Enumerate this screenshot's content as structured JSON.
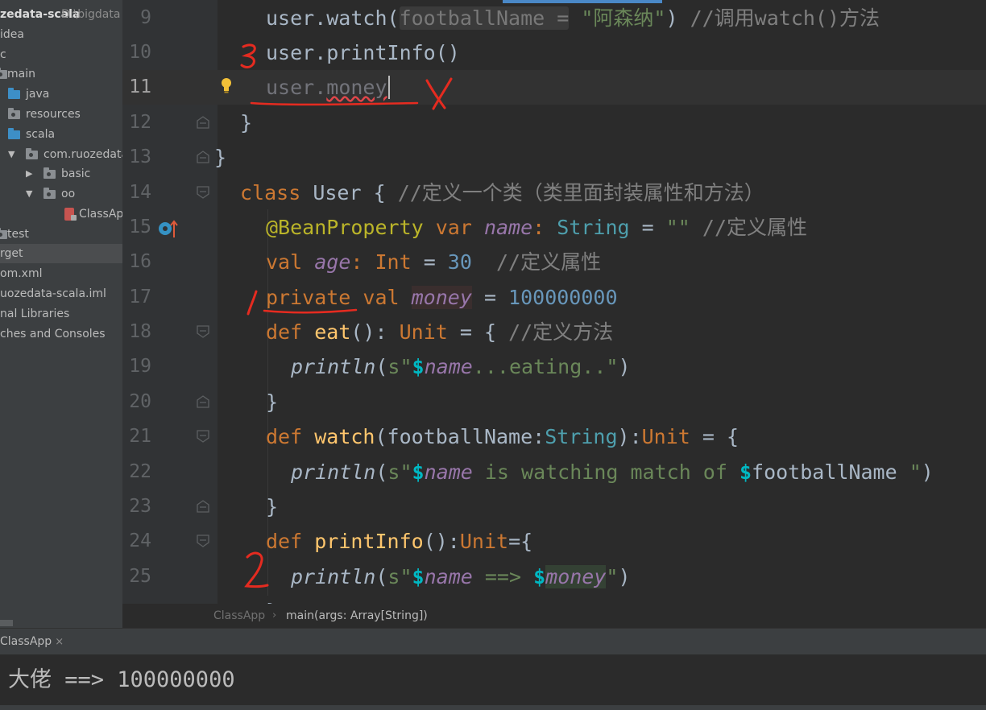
{
  "sidebar": {
    "project": {
      "name": "zedata-scala",
      "path": "D:\\bigdata"
    },
    "items": [
      {
        "label": "idea"
      },
      {
        "label": "c"
      },
      {
        "label": "main"
      },
      {
        "label": "java"
      },
      {
        "label": "resources"
      },
      {
        "label": "scala"
      },
      {
        "label": "com.ruozedata"
      },
      {
        "label": "basic"
      },
      {
        "label": "oo"
      },
      {
        "label": "ClassApp"
      },
      {
        "label": "test"
      },
      {
        "label": "rget"
      },
      {
        "label": "om.xml"
      },
      {
        "label": "uozedata-scala.iml"
      },
      {
        "label": "nal Libraries"
      },
      {
        "label": "ches and Consoles"
      }
    ]
  },
  "editor": {
    "line_numbers": [
      "9",
      "10",
      "11",
      "12",
      "13",
      "14",
      "15",
      "16",
      "17",
      "18",
      "19",
      "20",
      "21",
      "22",
      "23",
      "24",
      "25"
    ],
    "current_line": "11",
    "lines": {
      "l9": {
        "a": "user.watch(",
        "hint": "footballName =",
        "str": "\"阿森纳\"",
        "b": ") ",
        "cmt": "//调用watch()方法"
      },
      "l10": {
        "a": "user.printInfo()"
      },
      "l11": {
        "obj": "user.",
        "field": "money"
      },
      "l12": {
        "a": "}"
      },
      "l13": {
        "a": "}"
      },
      "l14": {
        "kw": "class",
        "name": " User { ",
        "cmt": "//定义一个类（类里面封装属性和方法）"
      },
      "l15": {
        "ann": "@BeanProperty",
        "kw": " var ",
        "field": "name",
        "colon": ": ",
        "type": "String",
        "eq": " = ",
        "str": "\"\"",
        "cmt": " //定义属性"
      },
      "l16": {
        "kw": "val ",
        "field": "age",
        "colon": ": ",
        "type": "Int",
        "eq": " = ",
        "num": "30",
        "cmt": "  //定义属性"
      },
      "l17": {
        "kw": "private val ",
        "field": "money",
        "eq": " = ",
        "num": "100000000"
      },
      "l18": {
        "kw": "def ",
        "fn": "eat",
        "paren": "(): ",
        "type": "Unit",
        "eq": " = { ",
        "cmt": "//定义方法"
      },
      "l19": {
        "fn": "println",
        "open": "(",
        "s": "s",
        "q1": "\"",
        "dollar": "$",
        "var": "name",
        "rest": "...eating..",
        "q2": "\"",
        "close": ")"
      },
      "l20": {
        "a": "}"
      },
      "l21": {
        "kw": "def ",
        "fn": "watch",
        "params": "(footballName:",
        "type": "String",
        "mid": "):",
        "type2": "Unit",
        "end": " = {"
      },
      "l22": {
        "fn": "println",
        "open": "(",
        "s": "s",
        "q1": "\"",
        "dollar": "$",
        "var": "name",
        "rest": " is watching match of ",
        "dollar2": "$",
        "var2": "footballName",
        "tail": " \"",
        "close": ")"
      },
      "l23": {
        "a": "}"
      },
      "l24": {
        "kw": "def ",
        "fn": "printInfo",
        "mid": "():",
        "type": "Unit",
        "end": "={"
      },
      "l25": {
        "fn": "println",
        "open": "(",
        "s": "s",
        "q1": "\"",
        "dollar": "$",
        "var": "name",
        "arrow": " ==> ",
        "dollar2": "$",
        "var2": "money",
        "q2": "\"",
        "close": ")"
      }
    }
  },
  "breadcrumb": {
    "file": "ClassApp",
    "method": "main(args: Array[String])"
  },
  "run": {
    "tab_label": "ClassApp",
    "close_icon": "×",
    "output": "大佬 ==> 100000000"
  },
  "annotations": {
    "mark1": "1",
    "mark2": "2",
    "mark3": "3",
    "cross": "X",
    "ink_color": "#e52b20"
  }
}
